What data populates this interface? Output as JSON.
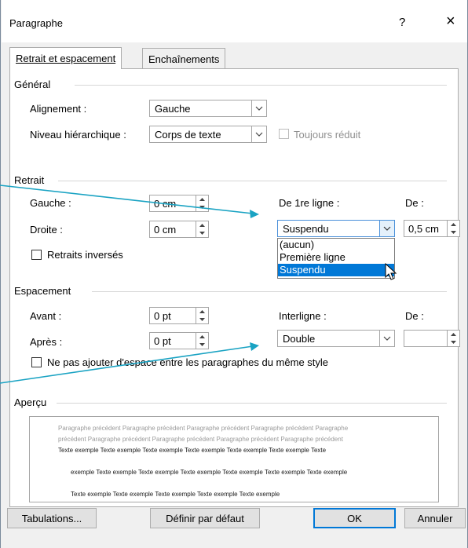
{
  "dialog": {
    "title": "Paragraphe",
    "help_label": "?",
    "close_label": "×"
  },
  "tabs": [
    {
      "label": "Retrait et espacement",
      "active": true
    },
    {
      "label": "Enchaînements",
      "active": false
    }
  ],
  "general": {
    "section_label": "Général",
    "alignment_label": "Alignement :",
    "alignment_value": "Gauche",
    "outline_label": "Niveau hiérarchique :",
    "outline_value": "Corps de texte",
    "collapsed_label": "Toujours réduit"
  },
  "indent": {
    "section_label": "Retrait",
    "left_label": "Gauche :",
    "left_value": "0 cm",
    "right_label": "Droite :",
    "right_value": "0 cm",
    "special_label": "De 1re ligne :",
    "special_value": "Suspendu",
    "by_label": "De :",
    "by_value": "0,5 cm",
    "mirror_label": "Retraits inversés",
    "special_options": [
      "(aucun)",
      "Première ligne",
      "Suspendu"
    ],
    "special_selected_index": 2
  },
  "spacing": {
    "section_label": "Espacement",
    "before_label": "Avant :",
    "before_value": "0 pt",
    "after_label": "Après :",
    "after_value": "0 pt",
    "line_label": "Interligne :",
    "line_value": "Double",
    "at_label": "De :",
    "at_value": "",
    "no_space_label": "Ne pas ajouter d'espace entre les paragraphes du même style"
  },
  "preview": {
    "section_label": "Aperçu",
    "prev_line_1": "Paragraphe précédent Paragraphe précédent Paragraphe précédent Paragraphe précédent Paragraphe",
    "prev_line_2": "précédent Paragraphe précédent Paragraphe précédent Paragraphe précédent Paragraphe précédent",
    "sample_line_1": "Texte exemple Texte exemple Texte exemple Texte exemple Texte exemple Texte exemple Texte",
    "sample_line_2": "exemple Texte exemple Texte exemple Texte exemple Texte exemple Texte exemple Texte exemple",
    "sample_line_3": "Texte exemple Texte exemple Texte exemple Texte exemple Texte exemple"
  },
  "buttons": {
    "tabs_label": "Tabulations...",
    "default_label": "Définir par défaut",
    "ok_label": "OK",
    "cancel_label": "Annuler"
  },
  "colors": {
    "accent": "#0078d7",
    "annotation_arrow": "#1aa3c3"
  }
}
